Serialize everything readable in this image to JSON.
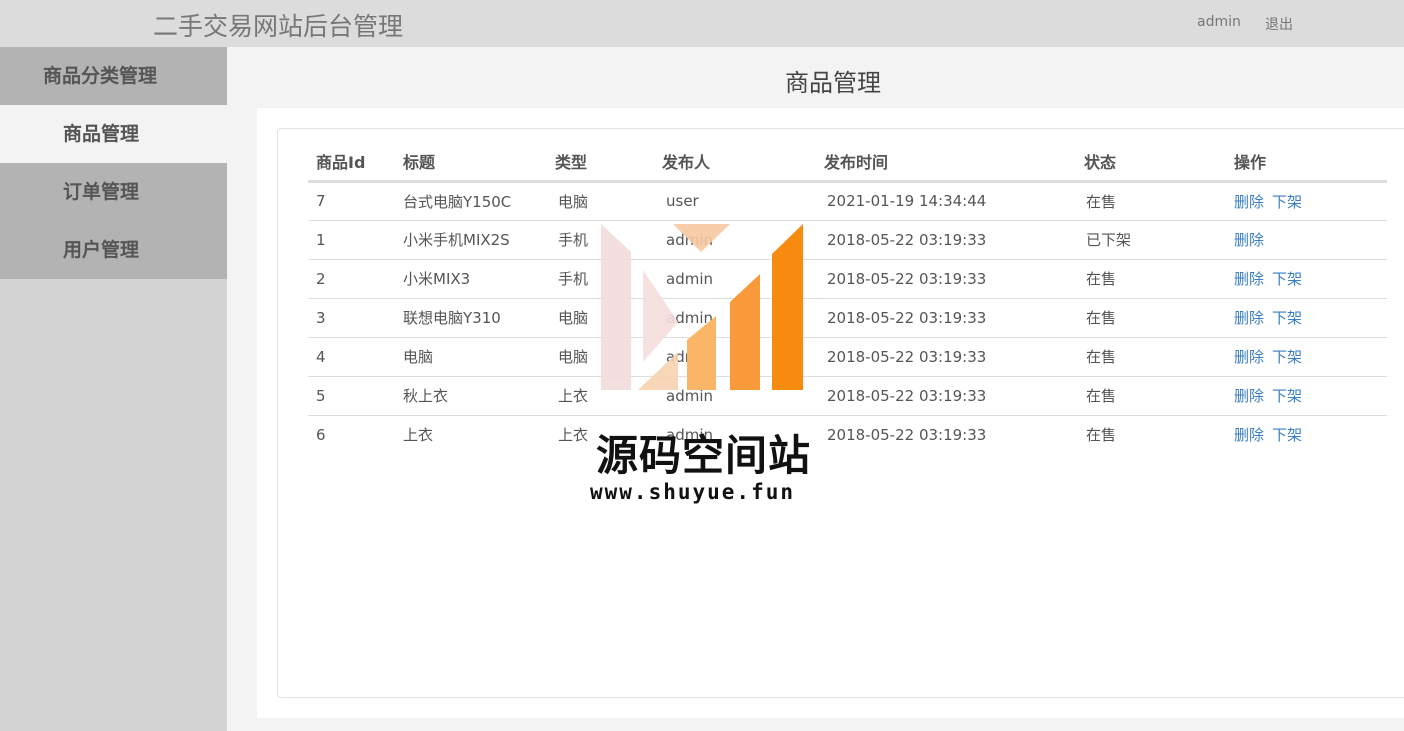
{
  "header": {
    "site_title": "二手交易网站后台管理",
    "user": "admin",
    "logout": "退出"
  },
  "sidebar": {
    "items": [
      {
        "label": "商品分类管理",
        "active": false
      },
      {
        "label": "商品管理",
        "active": true
      },
      {
        "label": "订单管理",
        "active": false
      },
      {
        "label": "用户管理",
        "active": false
      }
    ]
  },
  "main": {
    "title": "商品管理",
    "table": {
      "headers": [
        "商品Id",
        "标题",
        "类型",
        "发布人",
        "发布时间",
        "状态",
        "操作"
      ],
      "rows": [
        {
          "id": "7",
          "title": "台式电脑Y150C",
          "type": "电脑",
          "publisher": "user",
          "time": "2021-01-19 14:34:44",
          "status": "在售",
          "ops": [
            "删除",
            "下架"
          ]
        },
        {
          "id": "1",
          "title": "小米手机MIX2S",
          "type": "手机",
          "publisher": "admin",
          "time": "2018-05-22 03:19:33",
          "status": "已下架",
          "ops": [
            "删除"
          ]
        },
        {
          "id": "2",
          "title": "小米MIX3",
          "type": "手机",
          "publisher": "admin",
          "time": "2018-05-22 03:19:33",
          "status": "在售",
          "ops": [
            "删除",
            "下架"
          ]
        },
        {
          "id": "3",
          "title": "联想电脑Y310",
          "type": "电脑",
          "publisher": "admin",
          "time": "2018-05-22 03:19:33",
          "status": "在售",
          "ops": [
            "删除",
            "下架"
          ]
        },
        {
          "id": "4",
          "title": "电脑",
          "type": "电脑",
          "publisher": "admin",
          "time": "2018-05-22 03:19:33",
          "status": "在售",
          "ops": [
            "删除",
            "下架"
          ]
        },
        {
          "id": "5",
          "title": "秋上衣",
          "type": "上衣",
          "publisher": "admin",
          "time": "2018-05-22 03:19:33",
          "status": "在售",
          "ops": [
            "删除",
            "下架"
          ]
        },
        {
          "id": "6",
          "title": "上衣",
          "type": "上衣",
          "publisher": "admin",
          "time": "2018-05-22 03:19:33",
          "status": "在售",
          "ops": [
            "删除",
            "下架"
          ]
        }
      ]
    }
  },
  "watermark": {
    "text": "源码空间站",
    "url": "www.shuyue.fun",
    "colors": [
      "#f2d9d9",
      "#f7d1b0",
      "#fbb567",
      "#f99a3a",
      "#f78b10"
    ]
  },
  "colors": {
    "topbar": "#dcdcdc",
    "sidebar": "#d3d3d3",
    "sidebar_item": "#b3b3b3",
    "link": "#3a7ec4"
  }
}
